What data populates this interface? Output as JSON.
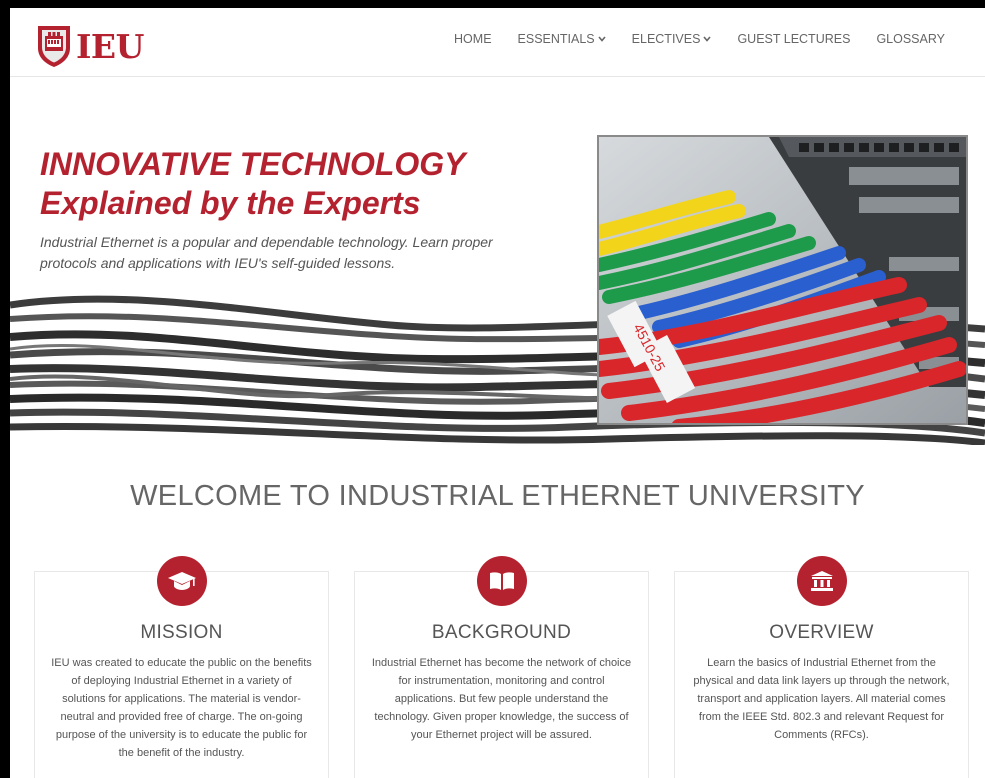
{
  "brand": {
    "name": "IEU",
    "accent": "#b5222f",
    "logo_icon": "shield-ethernet-icon"
  },
  "nav": {
    "home": "HOME",
    "essentials": "ESSENTIALS",
    "electives": "ELECTIVES",
    "guest_lectures": "GUEST LECTURES",
    "glossary": "GLOSSARY",
    "dropdown_icon": "chevron-down-icon"
  },
  "hero": {
    "title_line1": "INNOVATIVE TECHNOLOGY",
    "title_line2": "Explained by the Experts",
    "subtitle": "Industrial Ethernet is a popular and dependable technology. Learn proper protocols and applications with IEU's self-guided lessons.",
    "photo_label": "4510-25"
  },
  "welcome": {
    "title": "WELCOME TO INDUSTRIAL ETHERNET UNIVERSITY"
  },
  "cards": [
    {
      "icon": "graduation-cap-icon",
      "title": "MISSION",
      "text": "IEU was created to educate the public on the benefits of deploying Industrial Ethernet in a variety of solutions for applications. The material is vendor-neutral and provided free of charge. The on-going purpose of the university is to educate the public for the benefit of the industry."
    },
    {
      "icon": "book-icon",
      "title": "BACKGROUND",
      "text": "Industrial Ethernet has become the network of choice for instrumentation, monitoring and control applications. But few people understand the technology. Given proper knowledge, the success of your Ethernet project will be assured."
    },
    {
      "icon": "institution-icon",
      "title": "OVERVIEW",
      "text": "Learn the basics of Industrial Ethernet from the physical and data link layers up through the network, transport and application layers. All material comes from the IEEE Std. 802.3 and relevant Request for Comments (RFCs)."
    }
  ]
}
